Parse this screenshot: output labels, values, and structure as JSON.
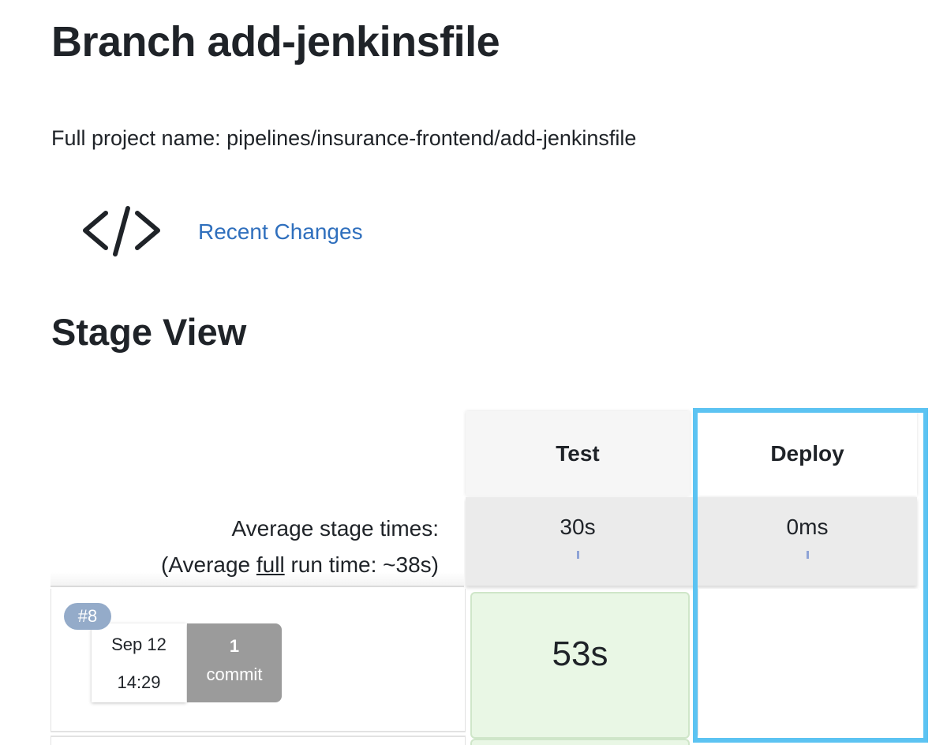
{
  "header": {
    "title": "Branch add-jenkinsfile",
    "full_project_name": "Full project name: pipelines/insurance-frontend/add-jenkinsfile"
  },
  "recent_changes": {
    "icon": "code-brackets-icon",
    "label": "Recent Changes"
  },
  "stage_view": {
    "title": "Stage View",
    "columns": [
      "Test",
      "Deploy"
    ],
    "average": {
      "label_line1": "Average stage times:",
      "label_line2_prefix": "(Average ",
      "label_line2_full": "full",
      "label_line2_suffix": " run time: ~38s)",
      "values": [
        "30s",
        "0ms"
      ]
    },
    "runs": [
      {
        "number": "#8",
        "date": "Sep 12",
        "time": "14:29",
        "commit_count": "1",
        "commit_label": "commit",
        "stage_times": [
          "53s",
          ""
        ]
      }
    ],
    "highlight_color": "#5cc3f2",
    "success_color": "#e9f7e5"
  }
}
